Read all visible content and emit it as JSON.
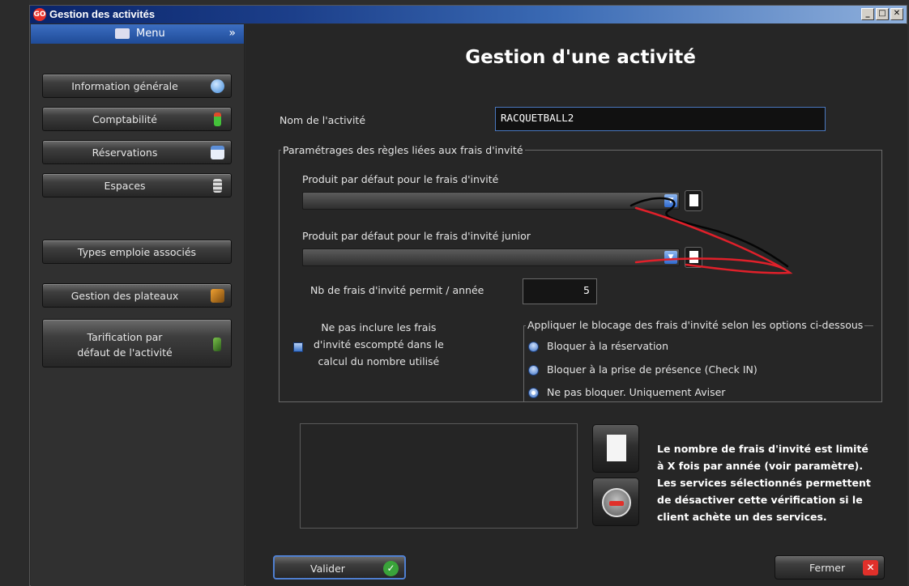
{
  "window": {
    "title": "Gestion des activités",
    "app_icon_text": "GO",
    "controls": [
      "_",
      "□",
      "✕"
    ]
  },
  "sidebar": {
    "header": "Menu",
    "items": [
      {
        "label": "Information générale",
        "icon": "globe-icon"
      },
      {
        "label": "Comptabilité",
        "icon": "battery-icon"
      },
      {
        "label": "Réservations",
        "icon": "calendar-icon"
      },
      {
        "label": "Espaces",
        "icon": "building-icon"
      },
      {
        "label": "Types emploie associés",
        "icon": ""
      },
      {
        "label": "Gestion des plateaux",
        "icon": "people-icon"
      },
      {
        "label": "Tarification par\ndéfaut de l'activité",
        "icon": "pencil-icon"
      }
    ]
  },
  "main": {
    "title": "Gestion d'une activité",
    "activity_name_label": "Nom de l'activité",
    "activity_name_value": "RACQUETBALL2",
    "guest_fee_group": {
      "legend": "Paramétrages des règles liées aux frais d'invité",
      "default_product_label": "Produit par défaut pour le frais d'invité",
      "default_product_value": "",
      "junior_product_label": "Produit par défaut pour le frais d'invité junior",
      "junior_product_value": "",
      "yearly_limit_label": "Nb de frais d'invité permit / année",
      "yearly_limit_value": "5",
      "exclude_discount_label": "Ne pas inclure les frais\nd'invité escompté dans le\ncalcul du nombre utilisé",
      "blocking_group": {
        "legend": "Appliquer le blocage des frais d'invité selon les options ci-dessous",
        "options": [
          {
            "label": "Bloquer à la réservation",
            "selected": false
          },
          {
            "label": "Bloquer à la prise de présence (Check IN)",
            "selected": false
          },
          {
            "label": "Ne pas bloquer. Uniquement Aviser",
            "selected": true
          }
        ]
      }
    },
    "info_text": "Le nombre de frais d'invité est limité\nà X fois par année (voir paramètre).\nLes services sélectionnés permettent\nde désactiver cette vérification si le\nclient achète un des services.",
    "validate_label": "Valider",
    "close_label": "Fermer"
  },
  "colors": {
    "accent": "#3c6ec2",
    "scribble_red": "#e0202a",
    "scribble_black": "#050505"
  }
}
